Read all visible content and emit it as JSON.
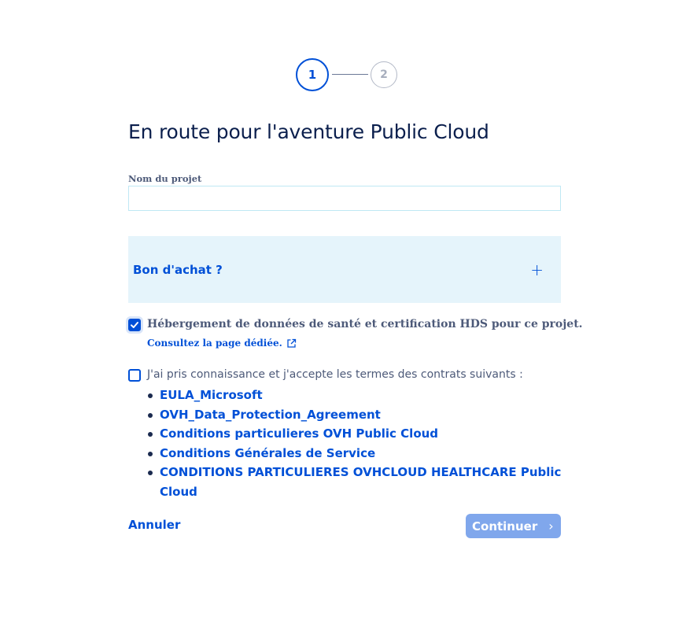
{
  "stepper": {
    "steps": [
      {
        "label": "1"
      },
      {
        "label": "2"
      }
    ]
  },
  "page": {
    "title": "En route pour l'aventure Public Cloud"
  },
  "project_name": {
    "label": "Nom du projet",
    "value": "",
    "placeholder": ""
  },
  "voucher": {
    "label": "Bon d'achat ?",
    "icon": "plus-icon"
  },
  "hds": {
    "checked": true,
    "text": "Hébergement de données de santé et certification HDS pour ce projet.",
    "link_label": "Consultez la page dédiée.",
    "link_icon": "external-link-icon"
  },
  "terms": {
    "checked": false,
    "text": "J'ai pris connaissance et j'accepte les termes des contrats suivants :",
    "contracts": [
      {
        "label": "EULA_Microsoft"
      },
      {
        "label": "OVH_Data_Protection_Agreement"
      },
      {
        "label": "Conditions particulieres OVH Public Cloud"
      },
      {
        "label": "Conditions Générales de Service"
      },
      {
        "label": "CONDITIONS PARTICULIERES OVHCLOUD HEALTHCARE Public Cloud"
      }
    ]
  },
  "actions": {
    "cancel_label": "Annuler",
    "continue_label": "Continuer",
    "continue_icon": "chevron-right-icon",
    "continue_disabled": true
  },
  "colors": {
    "primary": "#0050d7",
    "title": "#0b1f4d",
    "muted_text": "#4d5a79",
    "accordion_bg": "#e5f4fb",
    "disabled_button": "#80a7ec"
  }
}
